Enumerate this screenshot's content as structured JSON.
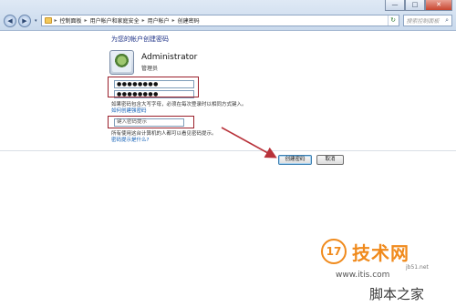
{
  "window": {
    "minimize": "—",
    "maximize": "□",
    "close": "✕"
  },
  "nav": {
    "back": "◀",
    "forward": "▶",
    "dropdown": "▾"
  },
  "breadcrumb": [
    "控制面板",
    "用户帐户和家庭安全",
    "用户帐户",
    "创建密码"
  ],
  "breadcrumb_sep": "▸",
  "search": {
    "placeholder": "搜索控制面板"
  },
  "page": {
    "heading": "为您的帐户创建密码",
    "username": "Administrator",
    "role": "管理员",
    "password": "●●●●●●●●",
    "password_confirm": "●●●●●●●●",
    "note1": "如果密码包含大写字母，必须在每次登录时以相同方式键入。",
    "link1": "如何创建强密码",
    "hint_placeholder": "键入密码提示",
    "note2": "所有使用这台计算机的人都可以看见密码提示。",
    "link2": "密码提示是什么?"
  },
  "buttons": {
    "create": "创建密码",
    "cancel": "取消"
  },
  "watermark": {
    "badge": "17",
    "main": "技术网",
    "site": "www.itis.com",
    "url": "jb51.net",
    "brand": "脚本之家"
  },
  "colors": {
    "annotation": "#9a1f2a",
    "link": "#0b5bb5",
    "heading": "#1e3287",
    "watermark": "#f08a1c"
  }
}
